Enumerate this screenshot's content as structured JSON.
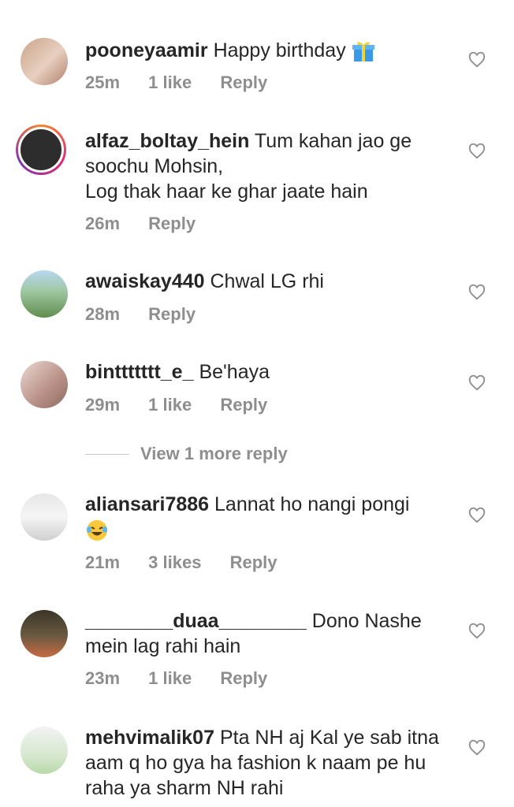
{
  "comments": [
    {
      "username": "pooneyaamir",
      "text": "Happy birthday",
      "emoji": "gift-emoji",
      "time": "25m",
      "likes": "1 like",
      "reply": "Reply"
    },
    {
      "username": "alfaz_boltay_hein",
      "text": "Tum kahan jao ge soochu Mohsin,",
      "text2": "Log thak  haar ke ghar jaate hain",
      "time": "26m",
      "reply": "Reply"
    },
    {
      "username": "awaiskay440",
      "text": "Chwal LG rhi",
      "time": "28m",
      "reply": "Reply"
    },
    {
      "username": "binttttttt_e_",
      "text": "Be'haya",
      "time": "29m",
      "likes": "1 like",
      "reply": "Reply"
    },
    {
      "username": "aliansari7886",
      "text": "Lannat ho nangi pongi",
      "emoji": "laughing-tears-emoji",
      "time": "21m",
      "likes": "3 likes",
      "reply": "Reply"
    },
    {
      "username": "________duaa________",
      "text": "Dono Nashe mein lag rahi hain",
      "time": "23m",
      "likes": "1 like",
      "reply": "Reply"
    },
    {
      "username": "mehvimalik07",
      "text": "Pta NH aj Kal ye sab itna aam q ho gya ha fashion k naam pe hu raha ya sharm NH rahi"
    }
  ],
  "view_more_replies": "View 1 more reply"
}
